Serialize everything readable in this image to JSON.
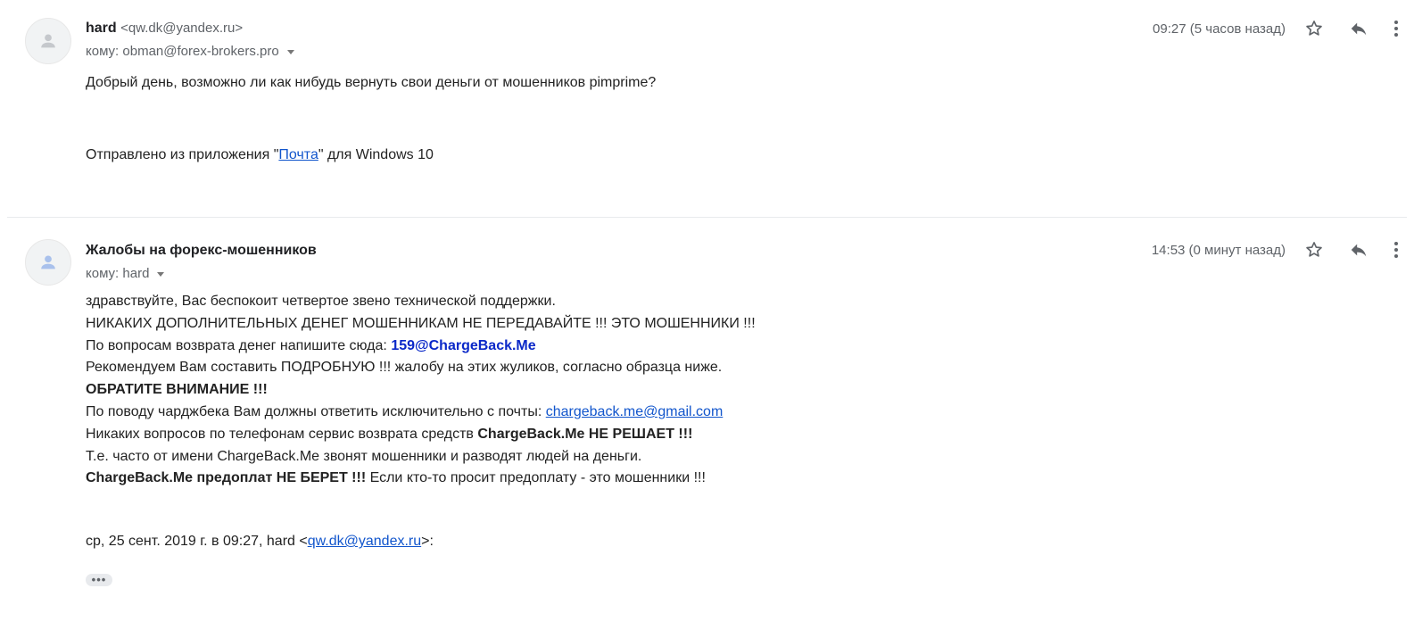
{
  "messages": [
    {
      "sender_name": "hard",
      "sender_email": "<qw.dk@yandex.ru>",
      "to_label": "кому:",
      "to_value": "obman@forex-brokers.pro",
      "timestamp": "09:27 (5 часов назад)",
      "body": {
        "line1": "Добрый день, возможно ли как нибудь вернуть свои деньги от мошенников pimprime?",
        "sent_from_prefix": "Отправлено из приложения \"",
        "sent_from_link": "Почта",
        "sent_from_suffix": "\" для Windows 10"
      }
    },
    {
      "sender_name": "Жалобы на форекс-мошенников",
      "to_label": "кому:",
      "to_value": "hard",
      "timestamp": "14:53 (0 минут назад)",
      "body": {
        "line1": "здравствуйте, Вас беспокоит четвертое звено технической поддержки.",
        "line2": "НИКАКИХ ДОПОЛНИТЕЛЬНЫХ ДЕНЕГ МОШЕННИКАМ НЕ ПЕРЕДАВАЙТЕ !!! ЭТО МОШЕННИКИ !!!",
        "line3_prefix": "По вопросам возврата денег напишите сюда: ",
        "line3_email": "159@ChargeBack.Me",
        "line4": "Рекомендуем Вам составить ПОДРОБНУЮ !!! жалобу на этих жуликов, согласно образца ниже.",
        "line5": "ОБРАТИТЕ ВНИМАНИЕ !!!",
        "line6_prefix": "По поводу чарджбека Вам должны ответить исключительно с почты: ",
        "line6_link": "chargeback.me@gmail.com",
        "line7_prefix": "Никаких вопросов по телефонам сервис возврата средств ",
        "line7_bold": "ChargeBack.Me НЕ РЕШАЕТ !!!",
        "line8": "Т.е. часто от имени ChargeBack.Me звонят мошенники и разводят людей на деньги.",
        "line9_bold": "ChargeBack.Me предоплат НЕ БЕРЕТ !!!",
        "line9_suffix": " Если кто-то просит предоплату - это мошенники !!!",
        "quote_prefix": "ср, 25 сент. 2019 г. в 09:27, hard <",
        "quote_link": "qw.dk@yandex.ru",
        "quote_suffix": ">:",
        "ellipsis": "•••"
      }
    }
  ],
  "icons": {
    "avatar": "person-icon",
    "star": "star-icon",
    "reply": "reply-icon",
    "more": "more-vert-icon"
  },
  "colors": {
    "link": "#1155cc",
    "highlight_email": "#0a28c8",
    "secondary_text": "#5f6368"
  }
}
